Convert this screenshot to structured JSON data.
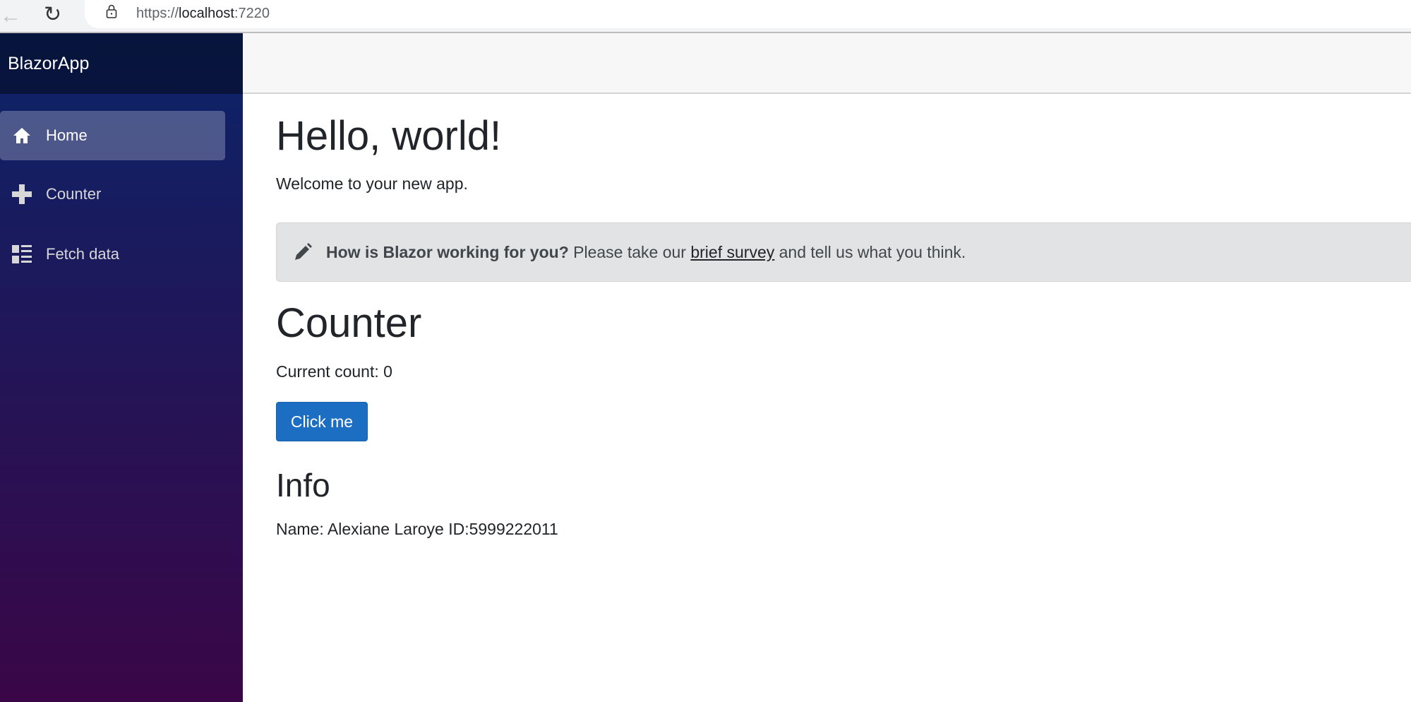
{
  "browser": {
    "url_scheme": "https://",
    "url_host": "localhost",
    "url_port": ":7220"
  },
  "sidebar": {
    "brand": "BlazorApp",
    "items": [
      {
        "label": "Home",
        "icon": "home-icon",
        "active": true
      },
      {
        "label": "Counter",
        "icon": "plus-icon"
      },
      {
        "label": "Fetch data",
        "icon": "list-icon"
      }
    ]
  },
  "main": {
    "title": "Hello, world!",
    "welcome": "Welcome to your new app.",
    "survey": {
      "bold": "How is Blazor working for you?",
      "pre": " Please take our ",
      "link": "brief survey",
      "post": " and tell us what you think."
    },
    "counter": {
      "title": "Counter",
      "count_text": "Current count: 0",
      "button": "Click me"
    },
    "info": {
      "title": "Info",
      "text": "Name: Alexiane Laroye ID:5999222011"
    }
  }
}
